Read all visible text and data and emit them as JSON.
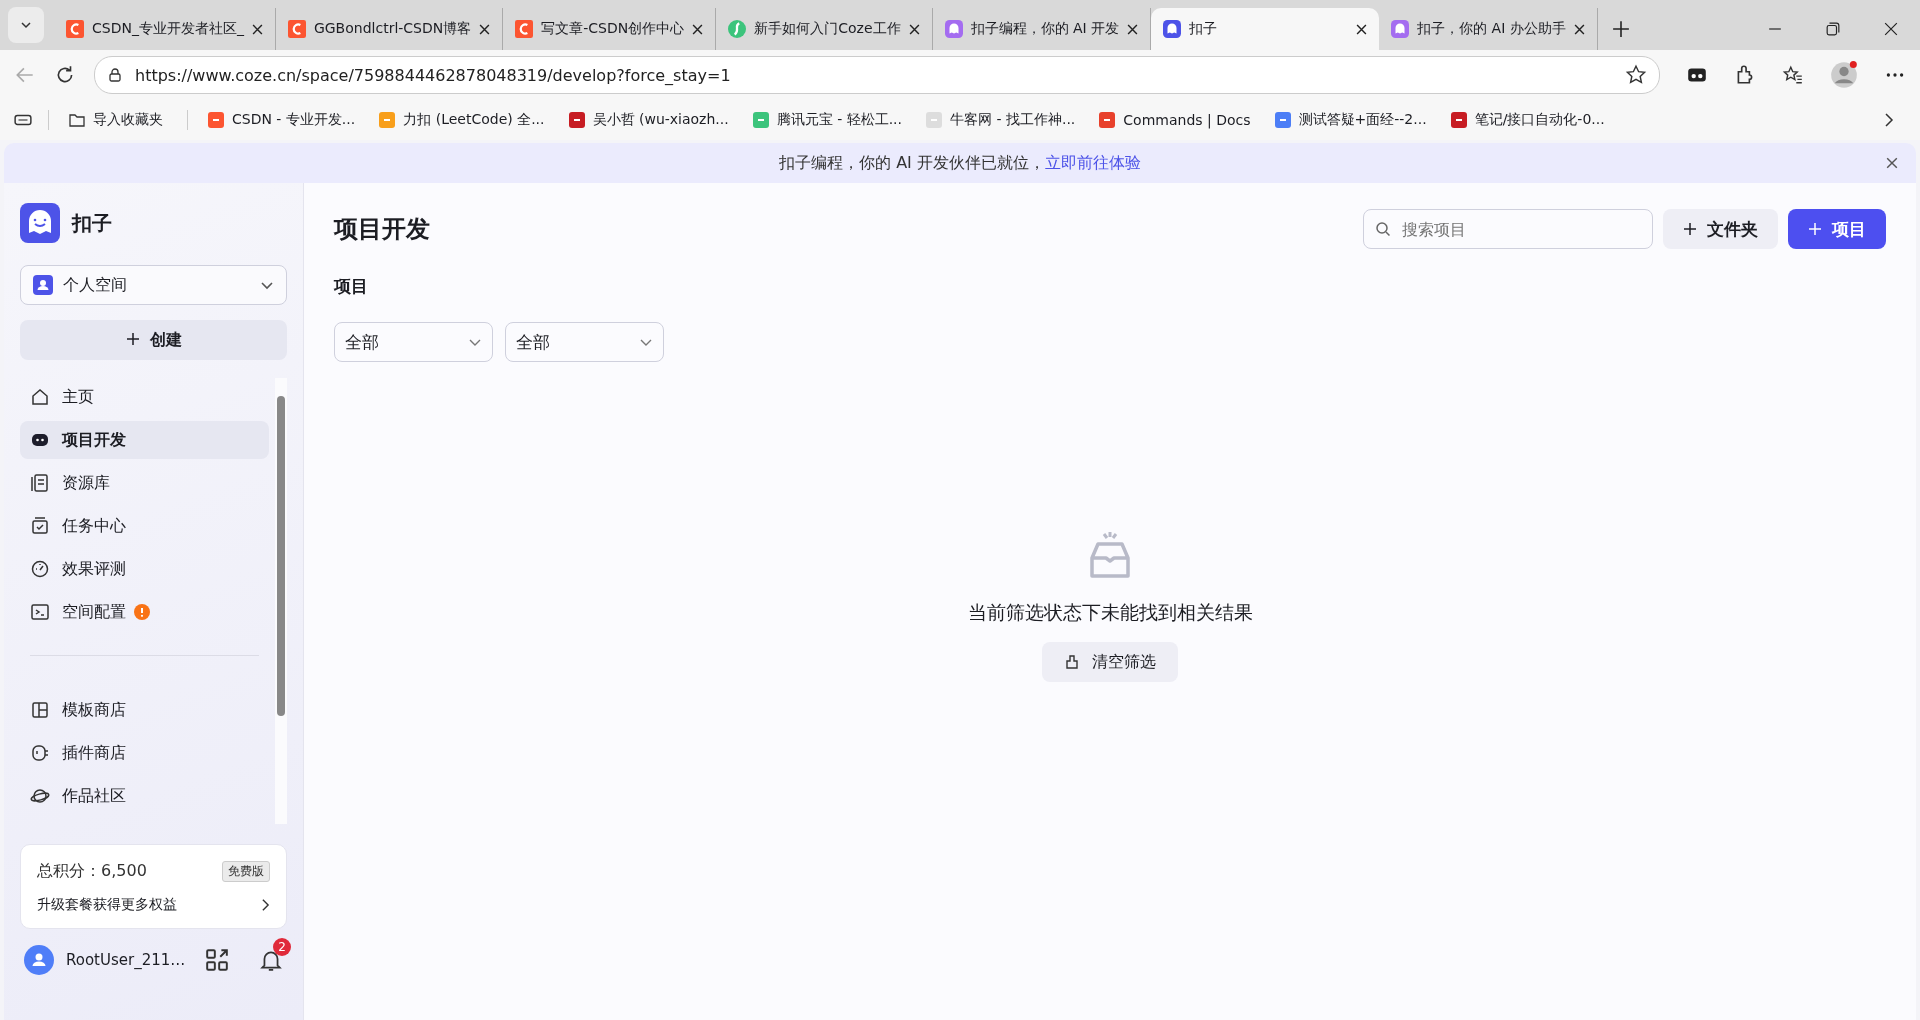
{
  "browser": {
    "tabs": [
      {
        "title": "CSDN_专业开发者社区_",
        "kind": "csdn",
        "selected": false
      },
      {
        "title": "GGBondlctrl-CSDN博客",
        "kind": "csdn",
        "selected": false
      },
      {
        "title": "写文章-CSDN创作中心",
        "kind": "csdn",
        "selected": false
      },
      {
        "title": "新手如何入门Coze工作",
        "kind": "green",
        "selected": false
      },
      {
        "title": "扣子编程，你的 AI 开发",
        "kind": "coze",
        "selected": false
      },
      {
        "title": "扣子",
        "kind": "coze",
        "selected": true
      },
      {
        "title": "扣子，你的 AI 办公助手",
        "kind": "coze",
        "selected": false
      }
    ],
    "url": "https://www.coze.cn/space/7598844462878048319/develop?force_stay=1",
    "bookmarks": [
      {
        "label": "导入收藏夹",
        "kind": "folder"
      },
      {
        "label": "CSDN - 专业开发...",
        "kind": "csdn"
      },
      {
        "label": "力扣 (LeetCode) 全...",
        "kind": "leetcode"
      },
      {
        "label": "吴小哲 (wu-xiaozh...",
        "kind": "gitee"
      },
      {
        "label": "腾讯元宝 - 轻松工...",
        "kind": "green"
      },
      {
        "label": "牛客网 - 找工作神...",
        "kind": "nowcoder"
      },
      {
        "label": "Commands | Docs",
        "kind": "docs"
      },
      {
        "label": "测试答疑+面经--2...",
        "kind": "doc"
      },
      {
        "label": "笔记/接口自动化-0...",
        "kind": "gitee"
      }
    ]
  },
  "banner": {
    "text": "扣子编程，你的 AI 开发伙伴已就位，",
    "link": "立即前往体验"
  },
  "sidebar": {
    "brand": "扣子",
    "space": "个人空间",
    "create": "创建",
    "items": [
      {
        "label": "主页",
        "kind": "home",
        "selected": false
      },
      {
        "label": "项目开发",
        "kind": "bot",
        "selected": true
      },
      {
        "label": "资源库",
        "kind": "library",
        "selected": false
      },
      {
        "label": "任务中心",
        "kind": "task",
        "selected": false
      },
      {
        "label": "效果评测",
        "kind": "gauge",
        "selected": false
      },
      {
        "label": "空间配置",
        "kind": "terminal",
        "selected": false,
        "alert": true
      }
    ],
    "items_2": [
      {
        "label": "模板商店",
        "kind": "template",
        "selected": false
      },
      {
        "label": "插件商店",
        "kind": "plugin",
        "selected": false
      },
      {
        "label": "作品社区",
        "kind": "planet",
        "selected": false
      }
    ],
    "points": {
      "label": "总积分：6,500",
      "plan": "免费版",
      "upgrade": "升级套餐获得更多权益"
    },
    "user": {
      "name": "RootUser_211…",
      "notifications": "2"
    }
  },
  "main": {
    "title": "项目开发",
    "search": {
      "placeholder": "搜索项目"
    },
    "folder_button": "文件夹",
    "project_button": "项目",
    "section": "项目",
    "filters": [
      "全部",
      "全部"
    ],
    "empty": {
      "message": "当前筛选状态下未能找到相关结果",
      "clear_button": "清空筛选"
    }
  }
}
